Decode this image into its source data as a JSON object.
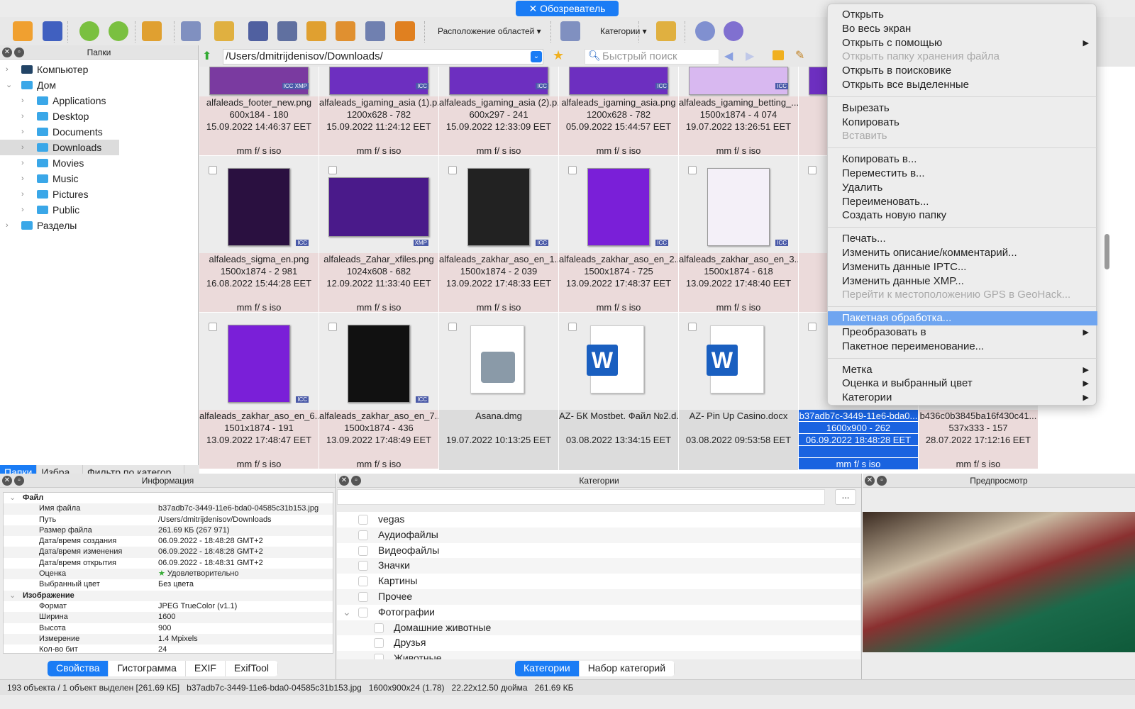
{
  "title": "Обозреватель",
  "toolbar": {
    "layout_label": "Расположение областей",
    "categories_label": "Категории",
    "icons": [
      "fullscreen-view-icon",
      "slideshow-icon",
      "rotate-left-icon",
      "rotate-right-icon",
      "convert-icon",
      "info-icon",
      "move-icon",
      "find-icon",
      "print-icon",
      "copy-to-icon",
      "move-to-icon",
      "screenshot-icon",
      "slideshow-projector-icon",
      "rating-icon",
      "compare-icon",
      "settings-icon",
      "help-icon"
    ]
  },
  "folders": {
    "title": "Папки",
    "items": [
      {
        "label": "Компьютер",
        "level": 0,
        "arrow": "›"
      },
      {
        "label": "Дом",
        "level": 0,
        "arrow": "⌄"
      },
      {
        "label": "Applications",
        "level": 1,
        "arrow": "›"
      },
      {
        "label": "Desktop",
        "level": 1,
        "arrow": "›"
      },
      {
        "label": "Documents",
        "level": 1,
        "arrow": "›"
      },
      {
        "label": "Downloads",
        "level": 1,
        "arrow": "›",
        "selected": true
      },
      {
        "label": "Movies",
        "level": 1,
        "arrow": "›"
      },
      {
        "label": "Music",
        "level": 1,
        "arrow": "›"
      },
      {
        "label": "Pictures",
        "level": 1,
        "arrow": "›"
      },
      {
        "label": "Public",
        "level": 1,
        "arrow": "›"
      },
      {
        "label": "Разделы",
        "level": 0,
        "arrow": "›"
      }
    ],
    "tabs": [
      "Папки",
      "Избра...",
      "Фильтр по категор..."
    ]
  },
  "path": {
    "value": "/Users/dmitrijdenisov/Downloads/",
    "search_placeholder": "Быстрый поиск"
  },
  "files": [
    [
      {
        "name": "alfaleads_footer_new.png",
        "dims": "600x184 - 180",
        "date": "15.09.2022 14:46:37 EET",
        "meta": "mm f/ s iso",
        "badges": "ICC XMP",
        "thumb": "#7a3aa0"
      },
      {
        "name": "alfaleads_igaming_asia (1).p...",
        "dims": "1200x628 - 782",
        "date": "15.09.2022 11:24:12 EET",
        "meta": "mm f/ s iso",
        "badges": "ICC",
        "thumb": "#6d2fc0"
      },
      {
        "name": "alfaleads_igaming_asia (2).p...",
        "dims": "600x297 - 241",
        "date": "15.09.2022 12:33:09 EET",
        "meta": "mm f/ s iso",
        "badges": "ICC",
        "thumb": "#6d2fc0"
      },
      {
        "name": "alfaleads_igaming_asia.png",
        "dims": "1200x628 - 782",
        "date": "05.09.2022 15:44:57 EET",
        "meta": "mm f/ s iso",
        "badges": "ICC",
        "thumb": "#6d2fc0"
      },
      {
        "name": "alfaleads_igaming_betting_...",
        "dims": "1500x1874 - 4 074",
        "date": "19.07.2022 13:26:51 EET",
        "meta": "mm f/ s iso",
        "badges": "ICC",
        "thumb": "#d8b8f0"
      },
      {
        "name": "alfa...",
        "dims": "",
        "date": "28.07...",
        "meta": "",
        "badges": "",
        "thumb": "#6d2fc0"
      }
    ],
    [
      {
        "name": "alfaleads_sigma_en.png",
        "dims": "1500x1874 - 2 981",
        "date": "16.08.2022 15:44:28 EET",
        "meta": "mm f/ s iso",
        "badges": "ICC",
        "thumb": "#2a1040",
        "tw": 88,
        "th": 110
      },
      {
        "name": "alfaleads_Zahar_xfiles.png",
        "dims": "1024x608 - 682",
        "date": "12.09.2022 11:33:40 EET",
        "meta": "mm f/ s iso",
        "badges": "XMP",
        "thumb": "#4a1a8a",
        "tw": 142,
        "th": 84
      },
      {
        "name": "alfaleads_zakhar_aso_en_1....",
        "dims": "1500x1874 - 2 039",
        "date": "13.09.2022 17:48:33 EET",
        "meta": "mm f/ s iso",
        "badges": "ICC",
        "thumb": "#222",
        "tw": 88,
        "th": 110
      },
      {
        "name": "alfaleads_zakhar_aso_en_2....",
        "dims": "1500x1874 - 725",
        "date": "13.09.2022 17:48:37 EET",
        "meta": "mm f/ s iso",
        "badges": "ICC",
        "thumb": "#7a1fd8",
        "tw": 88,
        "th": 110
      },
      {
        "name": "alfaleads_zakhar_aso_en_3....",
        "dims": "1500x1874 - 618",
        "date": "13.09.2022 17:48:40 EET",
        "meta": "mm f/ s iso",
        "badges": "ICC",
        "thumb": "#f4f0f8",
        "tw": 88,
        "th": 110
      },
      {
        "name": "alfalead...",
        "dims": "1...",
        "date": "13.0...",
        "meta": "",
        "badges": "",
        "thumb": "#ddd",
        "tw": 0,
        "th": 0
      }
    ],
    [
      {
        "name": "alfaleads_zakhar_aso_en_6....",
        "dims": "1501x1874 - 191",
        "date": "13.09.2022 17:48:47 EET",
        "meta": "mm f/ s iso",
        "badges": "ICC",
        "thumb": "#7a1fd8",
        "tw": 88,
        "th": 110
      },
      {
        "name": "alfaleads_zakhar_aso_en_7....",
        "dims": "1500x1874 - 436",
        "date": "13.09.2022 17:48:49 EET",
        "meta": "mm f/ s iso",
        "badges": "ICC",
        "thumb": "#111",
        "tw": 88,
        "th": 110
      },
      {
        "name": "Asana.dmg",
        "dims": "",
        "date": "19.07.2022 10:13:25 EET",
        "meta": "",
        "badges": "",
        "icon": "disk-image-icon",
        "gray": true
      },
      {
        "name": "AZ- БК Mostbet. Файл №2.d...",
        "dims": "",
        "date": "03.08.2022 13:34:15 EET",
        "meta": "",
        "badges": "",
        "icon": "word-document-icon",
        "gray": true
      },
      {
        "name": "AZ- Pin Up Casino.docx",
        "dims": "",
        "date": "03.08.2022 09:53:58 EET",
        "meta": "",
        "badges": "",
        "icon": "word-document-icon",
        "gray": true
      },
      {
        "name": "b37adb7c-3449-11e6-bda0...",
        "dims": "1600x900 - 262",
        "date": "06.09.2022 18:48:28 EET",
        "meta": "mm f/ s iso",
        "badges": "",
        "thumb": "#8a4a3a",
        "tw": 60,
        "th": 100,
        "selected": true
      },
      {
        "name": "b436c0b3845ba16f430c41...",
        "dims": "537x333 - 157",
        "date": "28.07.2022 17:12:16 EET",
        "meta": "mm f/ s iso",
        "badges": ""
      }
    ]
  ],
  "context_menu": [
    {
      "label": "Открыть"
    },
    {
      "label": "Во весь экран"
    },
    {
      "label": "Открыть с помощью",
      "sub": true
    },
    {
      "label": "Открыть папку хранения файла",
      "disabled": true
    },
    {
      "label": "Открыть в поисковике"
    },
    {
      "label": "Открыть все выделенные"
    },
    {
      "sep": true
    },
    {
      "label": "Вырезать"
    },
    {
      "label": "Копировать"
    },
    {
      "label": "Вставить",
      "disabled": true
    },
    {
      "sep": true
    },
    {
      "label": "Копировать в..."
    },
    {
      "label": "Переместить в..."
    },
    {
      "label": "Удалить"
    },
    {
      "label": "Переименовать..."
    },
    {
      "label": "Создать новую папку"
    },
    {
      "sep": true
    },
    {
      "label": "Печать..."
    },
    {
      "label": "Изменить описание/комментарий..."
    },
    {
      "label": "Изменить данные IPTC..."
    },
    {
      "label": "Изменить данные XMP..."
    },
    {
      "label": "Перейти к местоположению GPS в GeoHack...",
      "disabled": true
    },
    {
      "sep": true
    },
    {
      "label": "Пакетная обработка...",
      "highlighted": true
    },
    {
      "label": "Преобразовать в",
      "sub": true
    },
    {
      "label": "Пакетное переименование..."
    },
    {
      "sep": true
    },
    {
      "label": "Метка",
      "sub": true
    },
    {
      "label": "Оценка и выбранный цвет",
      "sub": true
    },
    {
      "label": "Категории",
      "sub": true
    }
  ],
  "info": {
    "title": "Информация",
    "rows": [
      {
        "group": "Файл"
      },
      {
        "k": "Имя файла",
        "v": "b37adb7c-3449-11e6-bda0-04585c31b153.jpg"
      },
      {
        "k": "Путь",
        "v": "/Users/dmitrijdenisov/Downloads"
      },
      {
        "k": "Размер файла",
        "v": "261.69 КБ (267 971)"
      },
      {
        "k": "Дата/время создания",
        "v": "06.09.2022 - 18:48:28 GMT+2"
      },
      {
        "k": "Дата/время изменения",
        "v": "06.09.2022 - 18:48:28 GMT+2"
      },
      {
        "k": "Дата/время открытия",
        "v": "06.09.2022 - 18:48:31 GMT+2"
      },
      {
        "k": "Оценка",
        "v": "Удовлетворительно",
        "star": true
      },
      {
        "k": "Выбранный цвет",
        "v": "Без цвета"
      },
      {
        "group": "Изображение"
      },
      {
        "k": "Формат",
        "v": "JPEG TrueColor (v1.1)"
      },
      {
        "k": "Ширина",
        "v": "1600"
      },
      {
        "k": "Высота",
        "v": "900"
      },
      {
        "k": "Измерение",
        "v": "1.4 Mpixels"
      },
      {
        "k": "Кол-во бит",
        "v": "24"
      }
    ],
    "tabs": [
      "Свойства",
      "Гистограмма",
      "EXIF",
      "ExifTool"
    ]
  },
  "categories": {
    "title": "Категории",
    "more": "...",
    "items": [
      {
        "label": "vegas",
        "level": 0
      },
      {
        "label": "Аудиофайлы",
        "level": 0
      },
      {
        "label": "Видеофайлы",
        "level": 0
      },
      {
        "label": "Значки",
        "level": 0
      },
      {
        "label": "Картины",
        "level": 0
      },
      {
        "label": "Прочее",
        "level": 0
      },
      {
        "label": "Фотографии",
        "level": 0,
        "expanded": true
      },
      {
        "label": "Домашние животные",
        "level": 1
      },
      {
        "label": "Друзья",
        "level": 1
      },
      {
        "label": "Животные",
        "level": 1
      }
    ],
    "tabs": [
      "Категории",
      "Набор категорий"
    ]
  },
  "preview": {
    "title": "Предпросмотр"
  },
  "status": [
    "193 объекта / 1 объект выделен [261.69 КБ]",
    "b37adb7c-3449-11e6-bda0-04585c31b153.jpg",
    "1600x900x24 (1.78)",
    "22.22x12.50 дюйма",
    "261.69 КБ"
  ],
  "colors": {
    "accent": "#1a7cf5",
    "selection": "#1a63e0",
    "menu_highlight": "#6fa5f0",
    "cell_bg": "#ebdada"
  }
}
